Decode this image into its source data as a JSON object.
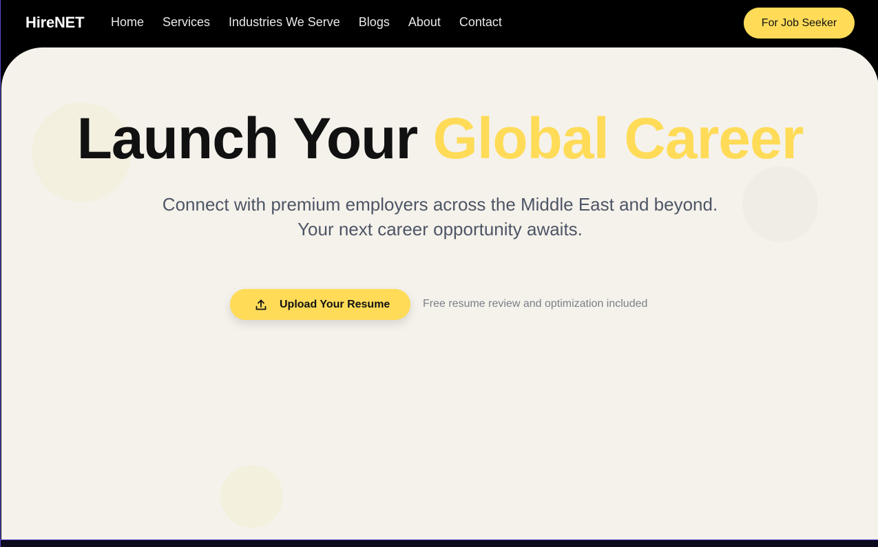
{
  "nav": {
    "logo": "HireNET",
    "links": [
      "Home",
      "Services",
      "Industries We Serve",
      "Blogs",
      "About",
      "Contact"
    ],
    "cta": "For Job Seeker"
  },
  "hero": {
    "title_main": "Launch Your ",
    "title_accent": "Global Career",
    "subtitle_line1": "Connect with premium employers across the Middle East and beyond.",
    "subtitle_line2": "Your next career opportunity awaits.",
    "upload_button": "Upload Your Resume",
    "upload_icon": "upload-icon",
    "note": "Free resume review and optimization included"
  },
  "colors": {
    "accent": "#ffdb58",
    "background": "#f5f2eb",
    "nav_background": "#000000",
    "heading": "#111111",
    "subtitle": "#4d5566"
  }
}
